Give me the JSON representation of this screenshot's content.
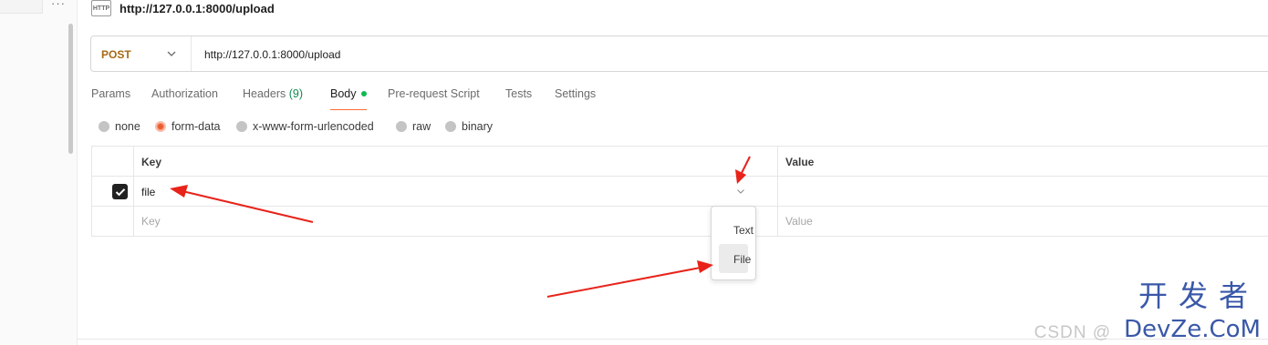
{
  "sidebar": {
    "more_icon": "···"
  },
  "request": {
    "icon_label": "HTTP",
    "title": "http://127.0.0.1:8000/upload"
  },
  "url_bar": {
    "method": "POST",
    "url": "http://127.0.0.1:8000/upload"
  },
  "tabs": {
    "params": "Params",
    "authorization": "Authorization",
    "headers": "Headers",
    "headers_count": "(9)",
    "body": "Body",
    "prerequest": "Pre-request Script",
    "tests": "Tests",
    "settings": "Settings"
  },
  "body_types": {
    "none": "none",
    "form_data": "form-data",
    "urlencoded": "x-www-form-urlencoded",
    "raw": "raw",
    "binary": "binary",
    "selected": "form-data"
  },
  "table": {
    "key_header": "Key",
    "value_header": "Value",
    "rows": [
      {
        "checked": true,
        "key": "file",
        "value": ""
      }
    ],
    "key_placeholder": "Key",
    "value_placeholder": "Value"
  },
  "type_dropdown": {
    "options": [
      "Text",
      "File"
    ],
    "highlighted": "File"
  },
  "watermark": {
    "csdn": "CSDN @",
    "cn": "开发者",
    "en": "DevZe.CoM"
  },
  "colors": {
    "accent": "#ff6c37",
    "method": "#a56a16",
    "arrow": "#e8231a",
    "watermark": "#3a58a8"
  }
}
